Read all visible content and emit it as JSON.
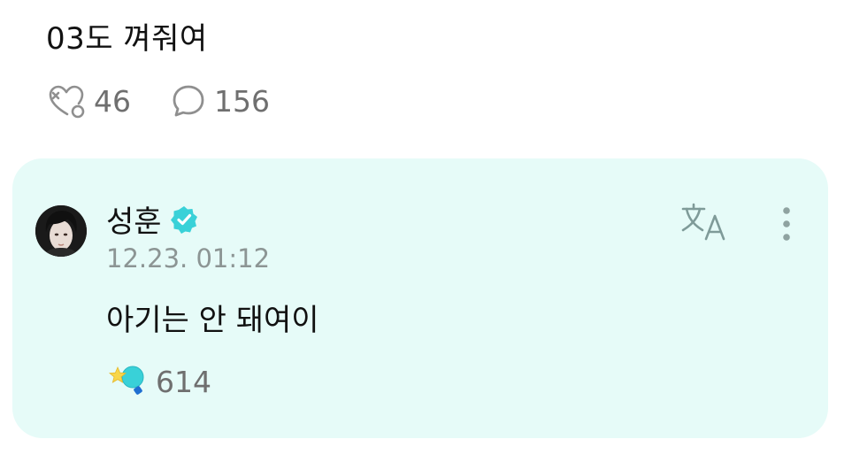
{
  "post": {
    "text": "03도 껴줘여",
    "like_count": "46",
    "comment_count": "156",
    "like_icon": "heart-plus-icon",
    "comment_icon": "speech-bubble-icon"
  },
  "reply": {
    "author": "성훈",
    "verified_icon": "verified-badge-icon",
    "timestamp": "12.23. 01:12",
    "text": "아기는 안 돼여이",
    "reaction_count": "614",
    "reaction_icon": "star-lightbulb-icon",
    "translate_icon": "translate-icon",
    "more_icon": "more-vertical-icon"
  },
  "colors": {
    "card_bg": "#e6fbf8",
    "accent": "#39d1d8",
    "muted_text": "#8c9594",
    "count_text": "#6f6f6f"
  }
}
